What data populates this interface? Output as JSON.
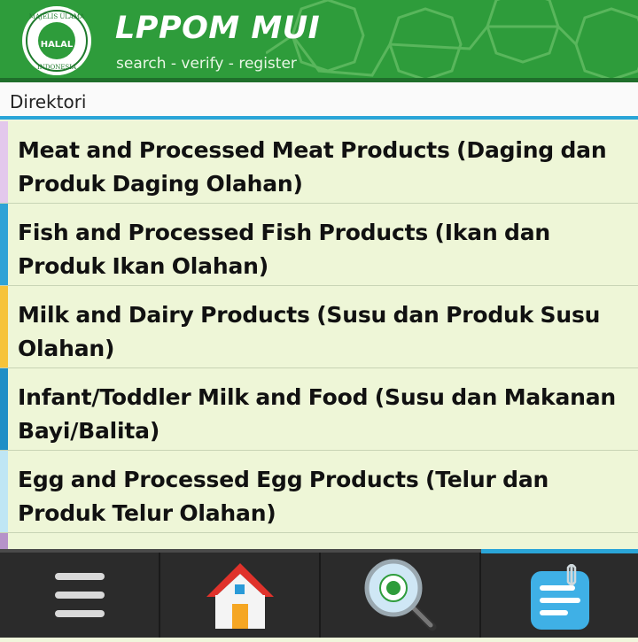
{
  "header": {
    "title": "LPPOM MUI",
    "subtitle": "search - verify - register",
    "logo_text_top": "MAJELIS ULAMA",
    "logo_text_bottom": "INDONESIA",
    "logo_center": "HALAL"
  },
  "section": {
    "label": "Direktori"
  },
  "list": {
    "items": [
      {
        "label": "Meat and Processed Meat Products (Daging dan Produk Daging Olahan)",
        "accent": "#e3c8ec"
      },
      {
        "label": "Fish and Processed Fish Products (Ikan dan Produk Ikan Olahan)",
        "accent": "#2fa3d6"
      },
      {
        "label": "Milk and Dairy Products (Susu dan Produk Susu Olahan)",
        "accent": "#f6c33a"
      },
      {
        "label": "Infant/Toddler Milk and Food (Susu dan Makanan Bayi/Balita)",
        "accent": "#1f8fc6"
      },
      {
        "label": "Egg and Processed Egg Products (Telur dan Produk Telur Olahan)",
        "accent": "#bfe6f4"
      }
    ]
  },
  "bottom_nav": {
    "items": [
      {
        "icon": "menu-icon",
        "active": false
      },
      {
        "icon": "home-icon",
        "active": false
      },
      {
        "icon": "search-certificate-icon",
        "active": false
      },
      {
        "icon": "notes-icon",
        "active": true
      }
    ]
  },
  "colors": {
    "header_green": "#2e9c3b",
    "accent_blue": "#2aa5d8",
    "list_bg": "#eef6d7"
  }
}
